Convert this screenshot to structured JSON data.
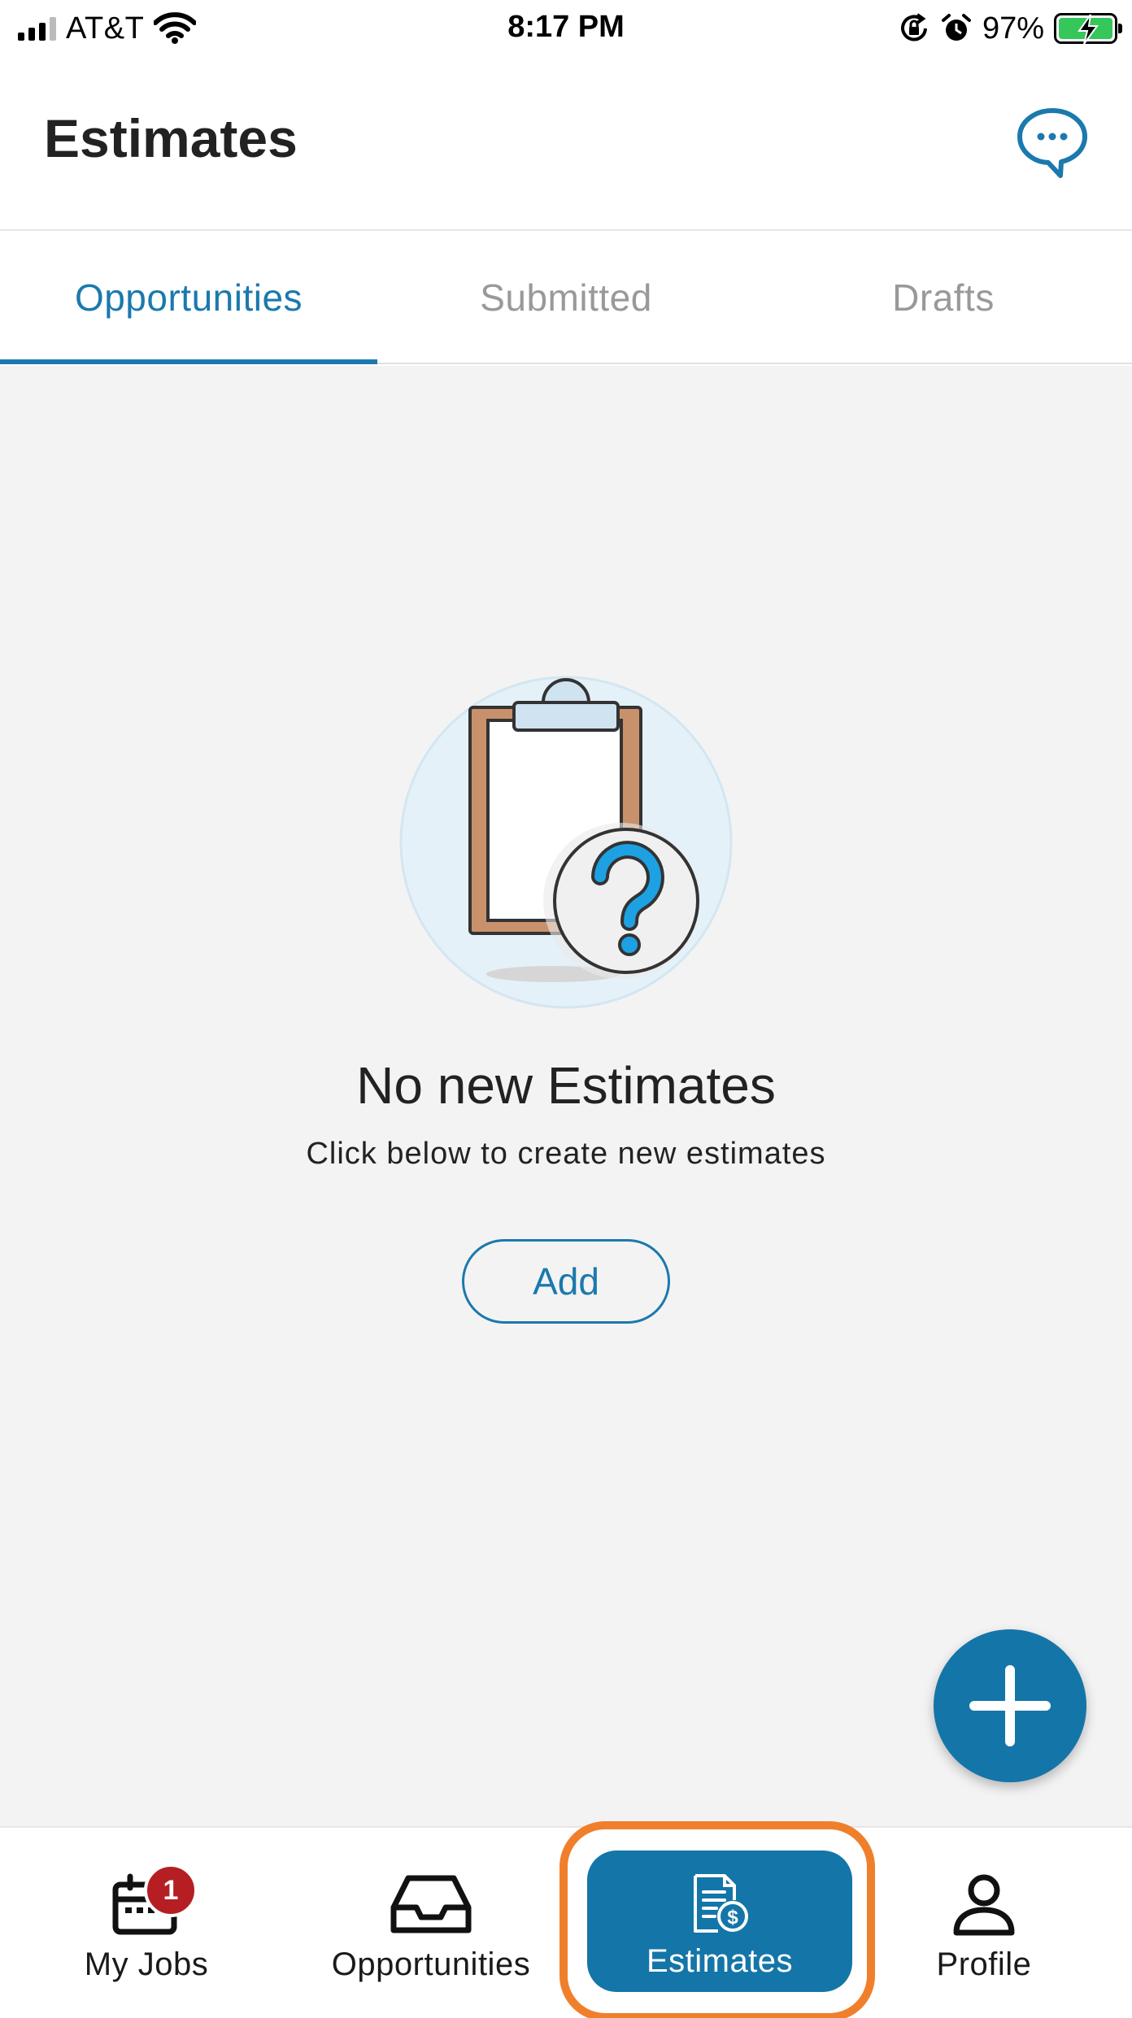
{
  "status_bar": {
    "carrier": "AT&T",
    "time": "8:17 PM",
    "battery": "97%"
  },
  "header": {
    "title": "Estimates",
    "chat_icon": "chat-bubble-icon"
  },
  "tabs": [
    {
      "label": "Opportunities",
      "active": true
    },
    {
      "label": "Submitted",
      "active": false
    },
    {
      "label": "Drafts",
      "active": false
    }
  ],
  "empty_state": {
    "illustration": "clipboard-question-icon",
    "title": "No new Estimates",
    "subtitle": "Click below to create new estimates",
    "add_label": "Add"
  },
  "fab": {
    "icon": "plus-icon"
  },
  "bottom_nav": [
    {
      "label": "My Jobs",
      "icon": "calendar-icon",
      "badge": "1"
    },
    {
      "label": "Opportunities",
      "icon": "inbox-tray-icon"
    },
    {
      "label": "Estimates",
      "icon": "document-dollar-icon",
      "active": true
    },
    {
      "label": "Profile",
      "icon": "person-icon"
    }
  ],
  "colors": {
    "accent": "#1b79ad",
    "highlight": "#f07f2c",
    "badge": "#b51f24"
  }
}
